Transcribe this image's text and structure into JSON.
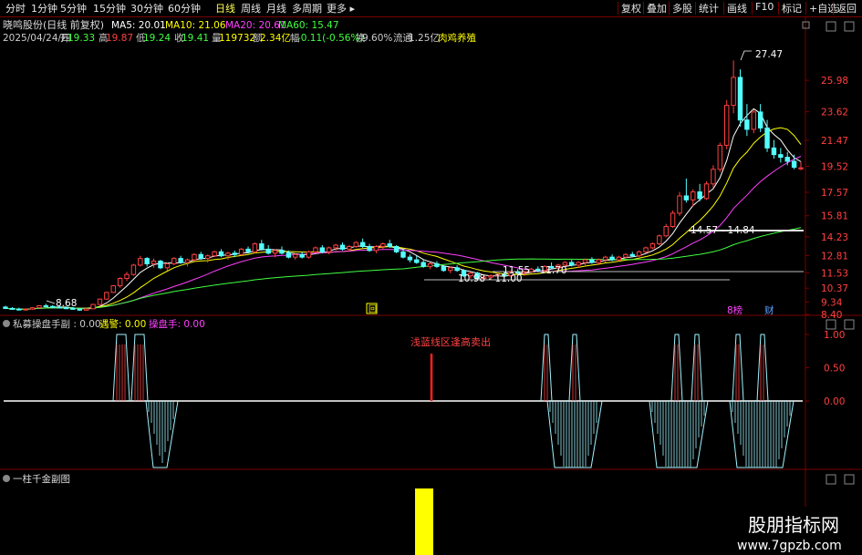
{
  "toolbar": {
    "tabs": [
      "分时",
      "1分钟",
      "5分钟",
      "15分钟",
      "30分钟",
      "60分钟",
      "日线",
      "周线",
      "月线",
      "多周期",
      "更多"
    ],
    "active_tab": "日线",
    "right_buttons": [
      "复权",
      "叠加",
      "多股",
      "统计",
      "画线",
      "F10",
      "标记",
      "+自选",
      "返回"
    ]
  },
  "main_panel": {
    "stock_title": "晓鸣股份(日线 前复权)",
    "ma_labels": [
      {
        "text": "MA5: 20.01",
        "color": "#ffffff"
      },
      {
        "text": "MA10: 21.06",
        "color": "#ffff00"
      },
      {
        "text": "MA20: 20.61",
        "color": "#ff40ff"
      },
      {
        "text": "MA60: 15.47",
        "color": "#40ff40"
      }
    ],
    "info_line": [
      {
        "text": "2025/04/24/四",
        "color": "#cccccc"
      },
      {
        "text": "开",
        "color": "#cccccc"
      },
      {
        "text": "19.33",
        "color": "#40ff40"
      },
      {
        "text": "高",
        "color": "#cccccc"
      },
      {
        "text": "19.87",
        "color": "#ff4040"
      },
      {
        "text": "低",
        "color": "#cccccc"
      },
      {
        "text": "19.24",
        "color": "#40ff40"
      },
      {
        "text": "收",
        "color": "#cccccc"
      },
      {
        "text": "19.41",
        "color": "#40ff40"
      },
      {
        "text": "量",
        "color": "#cccccc"
      },
      {
        "text": "119732",
        "color": "#ffff00"
      },
      {
        "text": "额",
        "color": "#cccccc"
      },
      {
        "text": "2.34亿",
        "color": "#ffff00"
      },
      {
        "text": "幅",
        "color": "#cccccc"
      },
      {
        "text": "-0.11(-0.56%)",
        "color": "#40ff40"
      },
      {
        "text": "换",
        "color": "#cccccc"
      },
      {
        "text": "9.60%",
        "color": "#cccccc"
      },
      {
        "text": "流通",
        "color": "#cccccc"
      },
      {
        "text": "1.25亿",
        "color": "#cccccc"
      },
      {
        "text": "肉鸡养殖",
        "color": "#ffff00"
      }
    ],
    "price_annotations": [
      "27.47",
      "8.68",
      "10.98 - 11.00",
      "11.55 - 11.70",
      "14.57 - 14.84"
    ],
    "markers": [
      "回",
      "8榜",
      "财"
    ]
  },
  "sub1": {
    "title": "私募操盘手副",
    "indicators": [
      {
        "label": "私募操盘手副 : 0.00",
        "color": "#cccccc"
      },
      {
        "label": "遇警: 0.00",
        "color": "#ffff00"
      },
      {
        "label": "操盘手: 0.00",
        "color": "#ff40ff"
      }
    ],
    "annotation": "浅蓝线区逢高卖出",
    "y_ticks": [
      "1.00",
      "0.50",
      "0.00"
    ]
  },
  "sub2": {
    "title": "一柱千金副图"
  },
  "watermark": {
    "cn": "股朋指标网",
    "url": "www.7gpzb.com"
  },
  "chart_data": {
    "type": "line",
    "y_ticks_main": [
      "25.98",
      "23.62",
      "21.47",
      "19.52",
      "17.57",
      "15.81",
      "14.23",
      "12.81",
      "11.53",
      "10.37",
      "9.34",
      "8.40"
    ],
    "ylim_main": [
      8.4,
      29.0
    ],
    "candles": [
      [
        8.95,
        9.05,
        8.8,
        8.85
      ],
      [
        8.85,
        8.95,
        8.75,
        8.8
      ],
      [
        8.8,
        8.9,
        8.7,
        8.75
      ],
      [
        8.75,
        8.85,
        8.68,
        8.8
      ],
      [
        8.8,
        8.95,
        8.75,
        8.9
      ],
      [
        8.9,
        9.1,
        8.85,
        9.05
      ],
      [
        9.05,
        9.2,
        8.95,
        9.0
      ],
      [
        9.0,
        9.1,
        8.9,
        8.95
      ],
      [
        8.95,
        9.05,
        8.85,
        8.9
      ],
      [
        8.9,
        9.0,
        8.8,
        8.85
      ],
      [
        8.85,
        8.95,
        8.75,
        8.8
      ],
      [
        8.8,
        8.85,
        8.68,
        8.72
      ],
      [
        8.72,
        8.85,
        8.68,
        8.82
      ],
      [
        8.82,
        9.2,
        8.8,
        9.15
      ],
      [
        9.15,
        9.6,
        9.1,
        9.55
      ],
      [
        9.55,
        10.1,
        9.5,
        10.05
      ],
      [
        10.05,
        10.6,
        10.0,
        10.55
      ],
      [
        10.55,
        11.2,
        10.4,
        11.1
      ],
      [
        11.1,
        11.6,
        10.9,
        11.4
      ],
      [
        11.4,
        12.2,
        11.3,
        12.1
      ],
      [
        12.1,
        12.8,
        12.0,
        12.6
      ],
      [
        12.6,
        12.7,
        12.0,
        12.2
      ],
      [
        12.2,
        12.6,
        11.9,
        12.4
      ],
      [
        12.4,
        12.5,
        11.8,
        11.9
      ],
      [
        11.9,
        12.3,
        11.7,
        12.2
      ],
      [
        12.2,
        12.7,
        12.1,
        12.6
      ],
      [
        12.6,
        12.8,
        12.2,
        12.3
      ],
      [
        12.3,
        12.6,
        12.0,
        12.5
      ],
      [
        12.5,
        13.0,
        12.4,
        12.9
      ],
      [
        12.9,
        13.1,
        12.5,
        12.6
      ],
      [
        12.6,
        12.9,
        12.3,
        12.8
      ],
      [
        12.8,
        13.2,
        12.7,
        13.1
      ],
      [
        13.1,
        13.3,
        12.7,
        12.8
      ],
      [
        12.8,
        13.1,
        12.5,
        13.0
      ],
      [
        13.0,
        13.2,
        12.7,
        12.9
      ],
      [
        12.9,
        13.4,
        12.8,
        13.3
      ],
      [
        13.3,
        13.5,
        13.0,
        13.1
      ],
      [
        13.1,
        13.8,
        13.0,
        13.7
      ],
      [
        13.7,
        14.0,
        13.2,
        13.3
      ],
      [
        13.3,
        13.6,
        12.9,
        13.0
      ],
      [
        13.0,
        13.3,
        12.7,
        13.2
      ],
      [
        13.2,
        13.5,
        12.9,
        13.0
      ],
      [
        13.0,
        13.2,
        12.6,
        12.7
      ],
      [
        12.7,
        13.0,
        12.5,
        12.9
      ],
      [
        12.9,
        13.1,
        12.6,
        12.7
      ],
      [
        12.7,
        13.2,
        12.6,
        13.1
      ],
      [
        13.1,
        13.5,
        13.0,
        13.4
      ],
      [
        13.4,
        13.6,
        13.0,
        13.1
      ],
      [
        13.1,
        13.5,
        12.9,
        13.4
      ],
      [
        13.4,
        13.7,
        13.2,
        13.6
      ],
      [
        13.6,
        13.8,
        13.2,
        13.3
      ],
      [
        13.3,
        13.6,
        13.1,
        13.5
      ],
      [
        13.5,
        13.9,
        13.4,
        13.8
      ],
      [
        13.8,
        14.1,
        13.4,
        13.5
      ],
      [
        13.5,
        13.7,
        13.1,
        13.2
      ],
      [
        13.2,
        13.6,
        13.0,
        13.5
      ],
      [
        13.5,
        13.8,
        13.3,
        13.7
      ],
      [
        13.7,
        14.0,
        13.4,
        13.5
      ],
      [
        13.5,
        13.6,
        13.0,
        13.1
      ],
      [
        13.1,
        13.3,
        12.6,
        12.7
      ],
      [
        12.7,
        12.9,
        12.3,
        12.5
      ],
      [
        12.5,
        12.8,
        12.2,
        12.3
      ],
      [
        12.3,
        12.5,
        11.9,
        12.0
      ],
      [
        12.0,
        12.3,
        11.8,
        12.2
      ],
      [
        12.2,
        12.4,
        11.9,
        12.0
      ],
      [
        12.0,
        12.1,
        11.6,
        11.7
      ],
      [
        11.7,
        12.0,
        11.5,
        11.9
      ],
      [
        11.9,
        12.1,
        11.6,
        11.7
      ],
      [
        11.7,
        11.8,
        11.2,
        11.3
      ],
      [
        11.3,
        11.6,
        11.1,
        11.5
      ],
      [
        11.5,
        11.6,
        11.0,
        11.1
      ],
      [
        11.1,
        11.3,
        10.98,
        11.2
      ],
      [
        11.2,
        11.4,
        11.0,
        11.3
      ],
      [
        11.3,
        11.5,
        11.1,
        11.4
      ],
      [
        11.4,
        11.6,
        11.2,
        11.3
      ],
      [
        11.3,
        11.7,
        11.2,
        11.6
      ],
      [
        11.6,
        11.8,
        11.4,
        11.5
      ],
      [
        11.5,
        11.7,
        11.3,
        11.6
      ],
      [
        11.6,
        11.9,
        11.5,
        11.8
      ],
      [
        11.8,
        12.0,
        11.55,
        11.7
      ],
      [
        11.7,
        12.1,
        11.6,
        12.0
      ],
      [
        12.0,
        12.3,
        11.8,
        11.9
      ],
      [
        11.9,
        12.2,
        11.7,
        12.1
      ],
      [
        12.1,
        12.4,
        12.0,
        12.3
      ],
      [
        12.3,
        12.5,
        12.0,
        12.1
      ],
      [
        12.1,
        12.4,
        11.9,
        12.3
      ],
      [
        12.3,
        12.6,
        12.1,
        12.5
      ],
      [
        12.5,
        12.7,
        12.2,
        12.3
      ],
      [
        12.3,
        12.6,
        12.1,
        12.5
      ],
      [
        12.5,
        12.8,
        12.3,
        12.7
      ],
      [
        12.7,
        12.9,
        12.4,
        12.5
      ],
      [
        12.5,
        12.8,
        12.4,
        12.7
      ],
      [
        12.7,
        13.0,
        12.6,
        12.9
      ],
      [
        12.9,
        13.1,
        12.7,
        12.8
      ],
      [
        12.8,
        13.2,
        12.7,
        13.1
      ],
      [
        13.1,
        13.5,
        13.0,
        13.4
      ],
      [
        13.4,
        13.8,
        13.3,
        13.7
      ],
      [
        13.7,
        14.4,
        13.6,
        14.3
      ],
      [
        14.3,
        15.2,
        14.2,
        15.0
      ],
      [
        15.0,
        16.2,
        14.9,
        16.0
      ],
      [
        16.0,
        17.6,
        15.8,
        17.3
      ],
      [
        17.3,
        18.6,
        16.8,
        17.0
      ],
      [
        17.0,
        17.8,
        16.5,
        17.6
      ],
      [
        17.6,
        18.2,
        16.9,
        17.1
      ],
      [
        17.1,
        18.4,
        17.0,
        18.2
      ],
      [
        18.2,
        19.6,
        17.9,
        19.3
      ],
      [
        19.3,
        21.3,
        19.1,
        21.1
      ],
      [
        21.1,
        24.5,
        20.8,
        24.1
      ],
      [
        24.1,
        27.47,
        23.5,
        26.2
      ],
      [
        26.2,
        26.8,
        22.5,
        23.0
      ],
      [
        23.0,
        24.2,
        21.8,
        22.3
      ],
      [
        22.3,
        23.8,
        22.0,
        23.6
      ],
      [
        23.6,
        24.2,
        22.1,
        22.4
      ],
      [
        22.4,
        23.0,
        20.6,
        20.9
      ],
      [
        20.9,
        21.5,
        20.1,
        20.4
      ],
      [
        20.4,
        20.9,
        19.8,
        20.2
      ],
      [
        20.2,
        20.6,
        19.6,
        19.9
      ],
      [
        19.9,
        20.4,
        19.3,
        19.45
      ],
      [
        19.33,
        19.87,
        19.24,
        19.41
      ]
    ],
    "ma5_color": "#ffffff",
    "ma10_color": "#ffff00",
    "ma20_color": "#ff40ff",
    "ma60_color": "#40ff40",
    "up_color": "#ff4040",
    "down_color": "#54ffff"
  }
}
